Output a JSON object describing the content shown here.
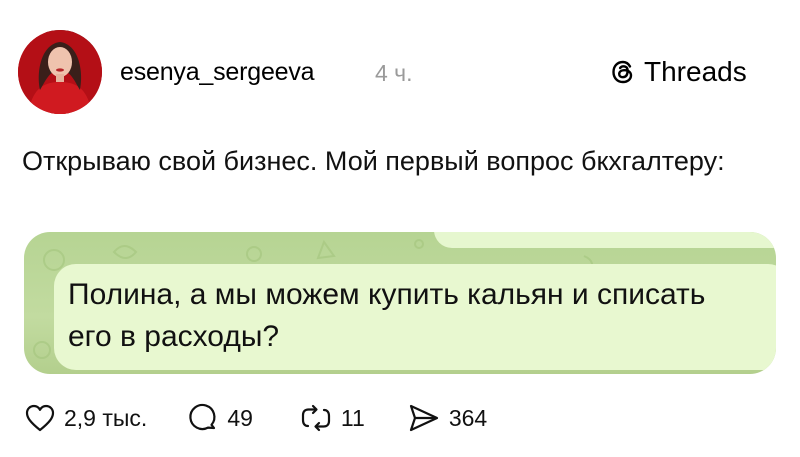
{
  "post": {
    "username": "esenya_sergeeva",
    "time": "4 ч.",
    "platform_label": "Threads",
    "text": "Открываю свой бизнес. Мой первый вопрос бкхгалтеру:"
  },
  "chat": {
    "message": "Полина, а мы можем купить кальян и списать его в расходы?"
  },
  "actions": {
    "likes": "2,9 тыс.",
    "replies": "49",
    "reposts": "11",
    "shares": "364"
  }
}
